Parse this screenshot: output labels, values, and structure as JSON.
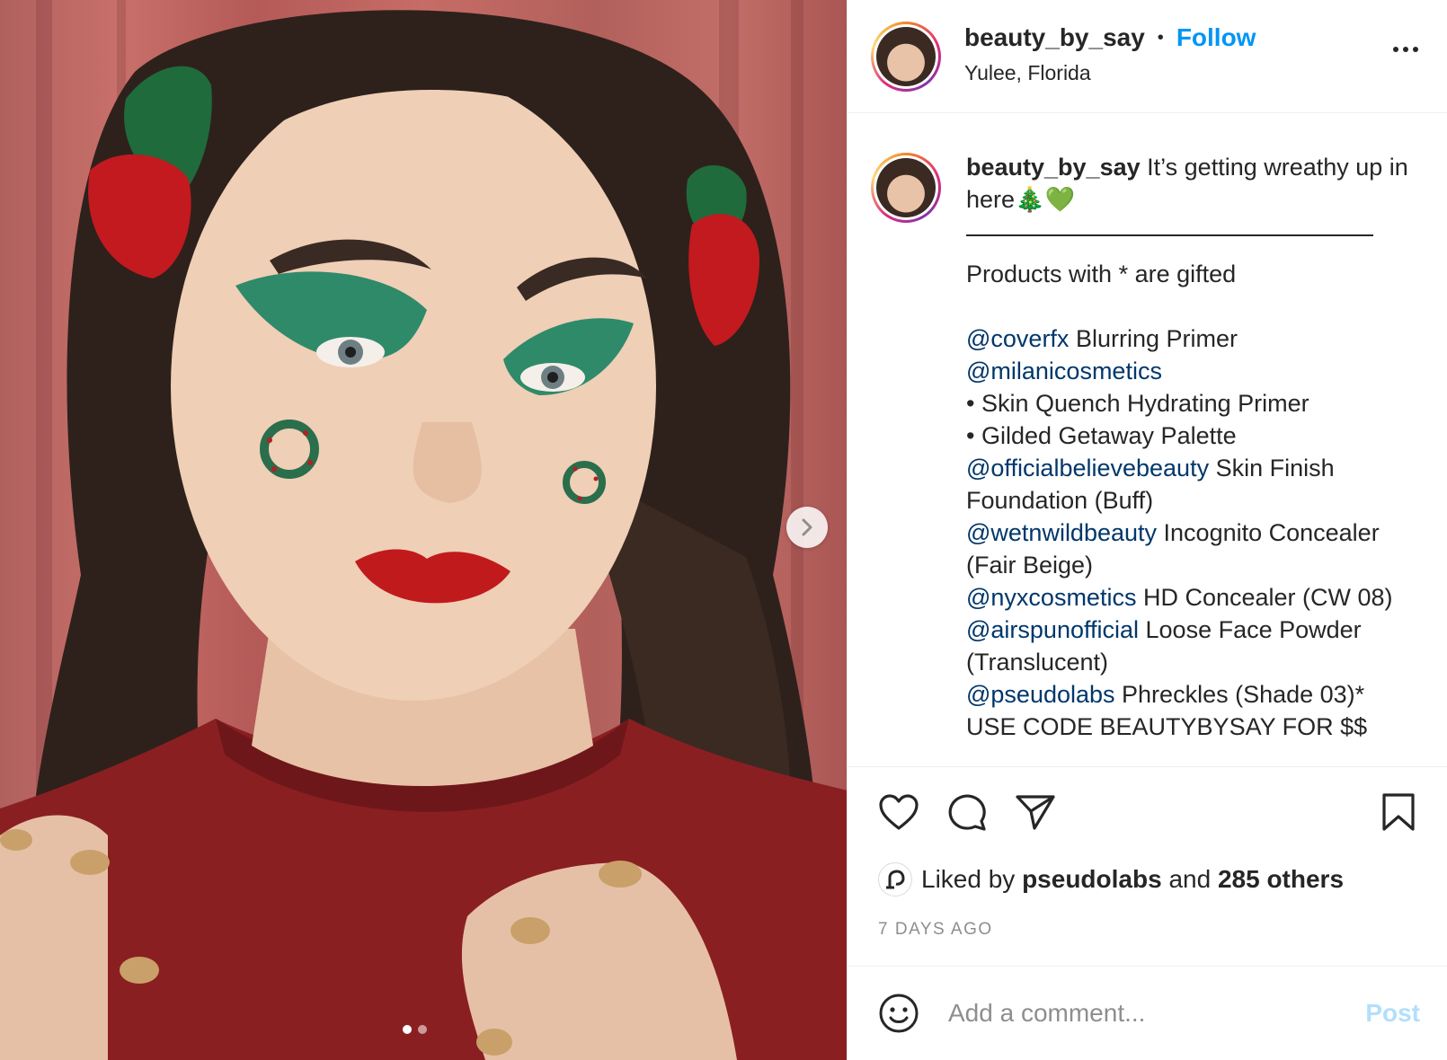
{
  "post": {
    "media": {
      "slide_count": 2,
      "active_slide": 1,
      "next_icon": "chevron-right-icon"
    },
    "header": {
      "username": "beauty_by_say",
      "separator": "•",
      "follow_label": "Follow",
      "location": "Yulee, Florida",
      "more_icon": "more-horizontal-icon"
    },
    "caption": {
      "username": "beauty_by_say",
      "text": "It’s getting wreathy up in here🎄💚",
      "products_note": "Products with * are gifted",
      "lines": [
        {
          "mention": "@coverfx",
          "text": " Blurring Primer"
        },
        {
          "mention": "@milanicosmetics",
          "text": ""
        },
        {
          "mention": "",
          "text": "• Skin Quench Hydrating Primer"
        },
        {
          "mention": "",
          "text": "• Gilded Getaway Palette"
        },
        {
          "mention": "@officialbelievebeauty",
          "text": " Skin Finish Foundation (Buff)"
        },
        {
          "mention": "@wetnwildbeauty",
          "text": " Incognito Concealer (Fair Beige)"
        },
        {
          "mention": "@nyxcosmetics",
          "text": " HD Concealer (CW 08)"
        },
        {
          "mention": "@airspunofficial",
          "text": " Loose Face Powder (Translucent)"
        },
        {
          "mention": "@pseudolabs",
          "text": " Phreckles (Shade 03)*"
        },
        {
          "mention": "",
          "text": "USE CODE BEAUTYBYSAY FOR $$"
        }
      ]
    },
    "actions": {
      "like_icon": "heart-icon",
      "comment_icon": "comment-icon",
      "share_icon": "share-icon",
      "save_icon": "bookmark-icon"
    },
    "likes": {
      "prefix": "Liked by",
      "user": "pseudolabs",
      "and": "and",
      "others": "285 others"
    },
    "date": "7 DAYS AGO",
    "comment": {
      "placeholder": "Add a comment...",
      "post_label": "Post",
      "emoji_icon": "smiley-icon"
    },
    "colors": {
      "accent": "#0095f6",
      "mention": "#00376b",
      "post_disabled": "#b2dffc",
      "muted": "#8e8e8e"
    }
  }
}
